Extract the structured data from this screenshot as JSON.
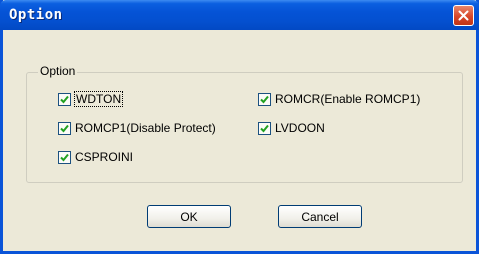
{
  "window": {
    "title": "Option",
    "close_icon": "close-icon"
  },
  "group": {
    "label": "Option"
  },
  "options": [
    {
      "label": "WDTON",
      "checked": true
    },
    {
      "label": "ROMCR(Enable ROMCP1)",
      "checked": true
    },
    {
      "label": "ROMCP1(Disable Protect)",
      "checked": true
    },
    {
      "label": "LVDOON",
      "checked": true
    },
    {
      "label": "CSPROINI",
      "checked": true
    }
  ],
  "buttons": {
    "ok": "OK",
    "cancel": "Cancel"
  },
  "colors": {
    "titlebar": "#0553d6",
    "dialog_bg": "#ece9d8",
    "check": "#21a121",
    "close": "#d8472a"
  }
}
